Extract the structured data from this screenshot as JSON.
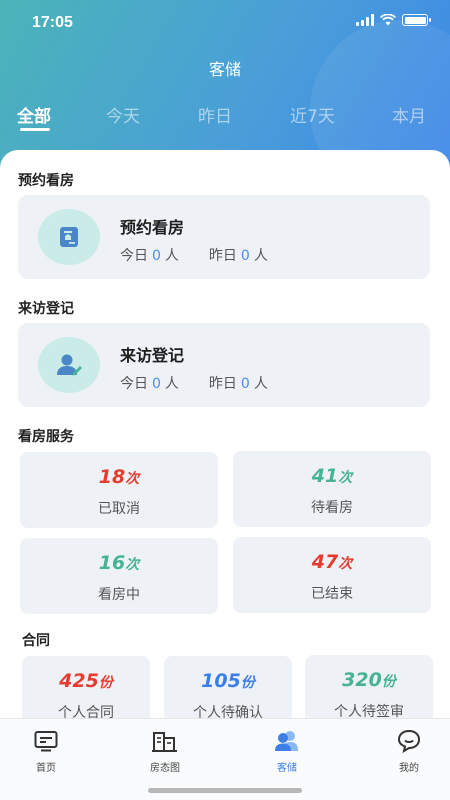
{
  "status_bar": {
    "time": "17:05"
  },
  "header": {
    "title": "客储"
  },
  "tabs": [
    {
      "label": "全部",
      "active": true
    },
    {
      "label": "今天",
      "active": false
    },
    {
      "label": "昨日",
      "active": false
    },
    {
      "label": "近7天",
      "active": false
    },
    {
      "label": "本月",
      "active": false
    }
  ],
  "sections": {
    "appointment": {
      "title": "预约看房",
      "card_title": "预约看房",
      "today_label": "今日",
      "today_value": "0",
      "yesterday_label": "昨日",
      "yesterday_value": "0",
      "unit": "人",
      "icon": "house-document-icon"
    },
    "visit": {
      "title": "来访登记",
      "card_title": "来访登记",
      "today_label": "今日",
      "today_value": "0",
      "yesterday_label": "昨日",
      "yesterday_value": "0",
      "unit": "人",
      "icon": "visitor-register-icon"
    },
    "viewing": {
      "title": "看房服务",
      "items": [
        {
          "value": "18",
          "unit": "次",
          "label": "已取消",
          "color": "#e63c2f"
        },
        {
          "value": "41",
          "unit": "次",
          "label": "待看房",
          "color": "#46b296"
        },
        {
          "value": "16",
          "unit": "次",
          "label": "看房中",
          "color": "#46b296"
        },
        {
          "value": "47",
          "unit": "次",
          "label": "已结束",
          "color": "#e63c2f"
        }
      ]
    },
    "contract": {
      "title": "合同",
      "items": [
        {
          "value": "425",
          "unit": "份",
          "label": "个人合同",
          "color": "#e63c2f"
        },
        {
          "value": "105",
          "unit": "份",
          "label": "个人待确认",
          "color": "#3c7ee8"
        },
        {
          "value": "320",
          "unit": "份",
          "label": "个人待签审",
          "color": "#46b296"
        }
      ]
    }
  },
  "bottom_nav": [
    {
      "label": "首页",
      "icon": "home-icon",
      "active": false
    },
    {
      "label": "房态图",
      "icon": "building-icon",
      "active": false
    },
    {
      "label": "客储",
      "icon": "customers-icon",
      "active": true
    },
    {
      "label": "我的",
      "icon": "profile-chat-icon",
      "active": false
    }
  ],
  "colors": {
    "accent": "#3d7fe6",
    "red": "#e63c2f",
    "green": "#46b296",
    "blue": "#3c7ee8"
  }
}
